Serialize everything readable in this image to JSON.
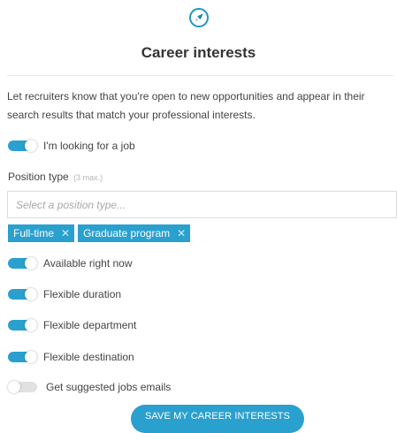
{
  "header": {
    "icon": "rocket-icon",
    "title": "Career interests"
  },
  "intro": "Let recruiters know that you're open to new opportunities and appear in their search results that match your professional interests.",
  "looking_toggle": {
    "label": "I'm looking for a job",
    "on": true
  },
  "position_type": {
    "label": "Position type",
    "hint": "(3 max.)",
    "placeholder": "Select a position type...",
    "tags": [
      {
        "label": "Full-time"
      },
      {
        "label": "Graduate program"
      }
    ]
  },
  "options": [
    {
      "label": "Available right now",
      "on": true
    },
    {
      "label": "Flexible duration",
      "on": true
    },
    {
      "label": "Flexible department",
      "on": true
    },
    {
      "label": "Flexible destination",
      "on": true
    },
    {
      "label": "Get suggested jobs emails",
      "on": false
    }
  ],
  "save_button": "SAVE MY CAREER INTERESTS",
  "colors": {
    "accent": "#2aa0cf",
    "toggle_off": "#e1e1e1",
    "title_text": "#333333"
  }
}
